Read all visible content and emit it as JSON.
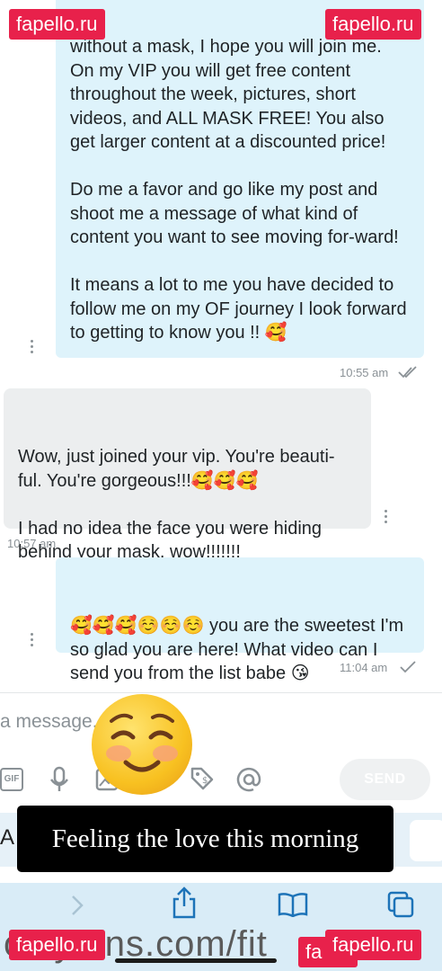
{
  "watermarks": {
    "top_left": "fapello.ru",
    "top_right": "fapello.ru",
    "bottom_left": "fapello.ru",
    "bottom_right": "fapello.ru",
    "bottom_partial": "fa"
  },
  "messages": [
    {
      "direction": "outgoing",
      "text": "without a mask, I hope you will join me.\nOn my VIP you will get free content throughout the week, pictures, short videos, and ALL MASK FREE! You also get larger content at a discounted price!\n\nDo me a favor and go like my post and shoot me a message of what kind of content you want to see moving for-ward!\n\nIt means a lot to me you have decided to follow me on my OF journey I look forward to getting to know you !! 🥰",
      "time": "10:55 am",
      "status": "read"
    },
    {
      "direction": "incoming",
      "text": "Wow, just joined your vip. You're beauti-ful. You're gorgeous!!!🥰🥰🥰\n\nI had no idea the face you were hiding behind your mask, wow!!!!!!!",
      "time": "10:57 am"
    },
    {
      "direction": "outgoing",
      "text": "🥰🥰🥰☺️☺️☺️ you are the sweetest I'm so glad you are here! What video can I send you from the list babe 😘",
      "time": "11:04 am",
      "status": "sent"
    }
  ],
  "composer": {
    "placeholder": "a message.",
    "send_label": "SEND"
  },
  "toolbar": {
    "gif_label": "GIF"
  },
  "caption": "Feeling the love this morning",
  "browser": {
    "url_text": "onlyfans.com/fit",
    "left_fragment": "A"
  },
  "colors": {
    "outgoing_bubble": "#def3fb",
    "incoming_bubble": "#eceeef",
    "watermark": "#e8214b",
    "browser_bar": "#d9ecf7"
  }
}
